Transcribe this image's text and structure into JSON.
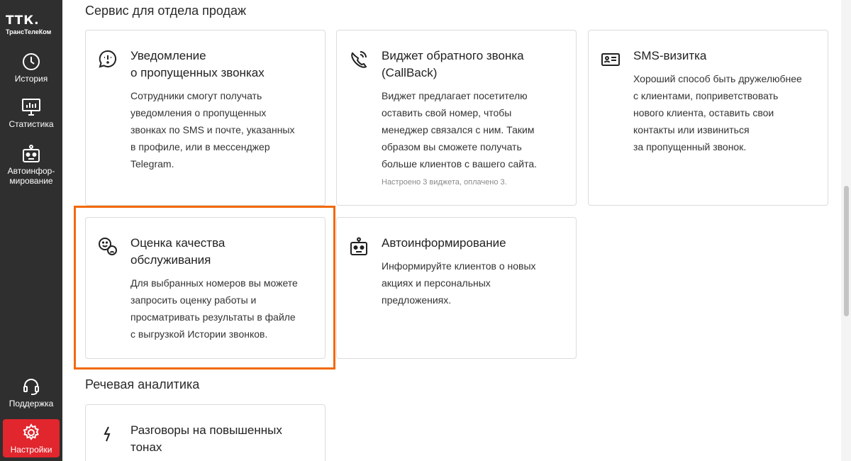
{
  "brand": {
    "mark": "ТТК.",
    "name": "ТрансТелеКом"
  },
  "sidebar": {
    "items": [
      {
        "label": "История",
        "icon": "clock-icon"
      },
      {
        "label": "Статистика",
        "icon": "chart-monitor-icon"
      },
      {
        "label": "Автоинфор-мирование",
        "line1": "Автоинфор-",
        "line2": "мирование",
        "icon": "robot-icon"
      }
    ],
    "bottom": [
      {
        "label": "Поддержка",
        "icon": "headset-icon"
      },
      {
        "label": "Настройки",
        "icon": "gear-icon",
        "active": true
      }
    ]
  },
  "sections": [
    {
      "title": "Сервис для отдела продаж",
      "cards": [
        {
          "title_line1": "Уведомление",
          "title_line2": "о пропущенных звонках",
          "desc": [
            "Сотрудники смогут получать",
            "уведомления о пропущенных",
            "звонках по SMS и почте, указанных",
            "в профиле, или в мессенджер",
            "Telegram."
          ],
          "icon": "chat-alert-icon"
        },
        {
          "title_line1": "Виджет обратного звонка",
          "title_line2": "(CallBack)",
          "desc": [
            "Виджет предлагает посетителю",
            "оставить свой номер, чтобы",
            "менеджер связался с ним. Таким",
            "образом вы сможете получать",
            "больше клиентов с вашего сайта."
          ],
          "note": "Настроено 3 виджета, оплачено 3.",
          "icon": "phone-callback-icon"
        },
        {
          "title_line1": "SMS-визитка",
          "desc": [
            "Хороший способ быть дружелюбнее",
            "с клиентами, поприветствовать",
            "нового клиента, оставить свои",
            "контакты или извиниться",
            "за пропущенный звонок."
          ],
          "icon": "id-card-icon"
        },
        {
          "title_line1": "Оценка качества",
          "title_line2": "обслуживания",
          "desc": [
            "Для выбранных номеров вы можете",
            "запросить оценку работы и",
            "просматривать результаты в файле",
            "с выгрузкой Истории звонков."
          ],
          "icon": "smile-rating-icon"
        },
        {
          "title_line1": "Автоинформирование",
          "desc": [
            "Информируйте клиентов о новых",
            "акциях и персональных",
            "предложениях."
          ],
          "icon": "robot-icon"
        }
      ]
    },
    {
      "title": "Речевая аналитика",
      "cards": [
        {
          "title_line1": "Разговоры на повышенных",
          "title_line2": "тонах",
          "icon": "lightning-icon"
        }
      ]
    }
  ],
  "colors": {
    "sidebar": "#2f2f2f",
    "active": "#e1262d",
    "highlight": "#f26a0b"
  }
}
